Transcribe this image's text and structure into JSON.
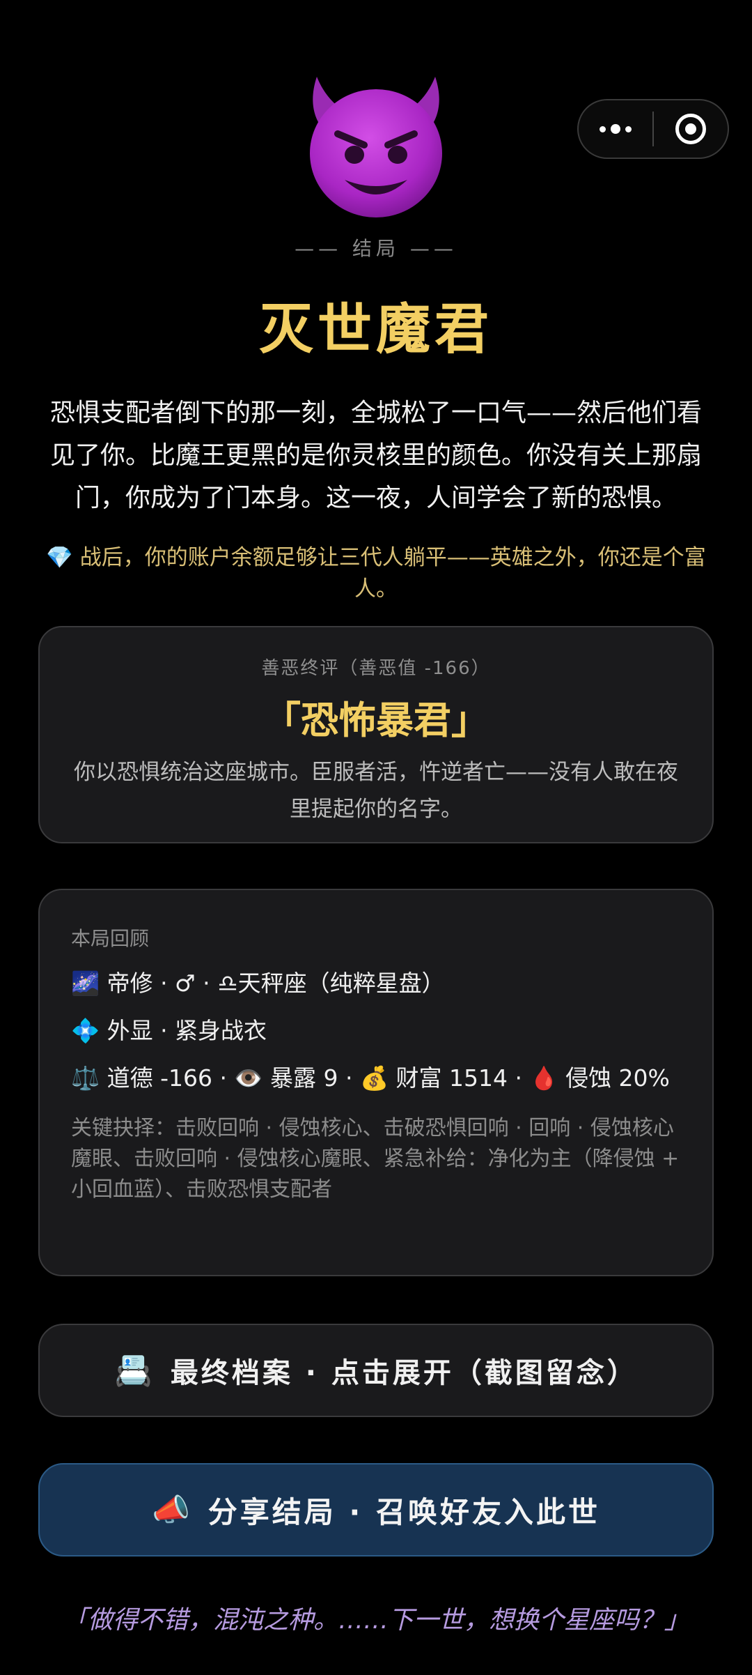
{
  "menu": {
    "more_icon": "more-dots-icon",
    "close_icon": "target-circle-icon"
  },
  "ending": {
    "emoji": "smiling-devil-icon",
    "label": "—— 结局 ——",
    "title": "灭世魔君",
    "story": "恐惧支配者倒下的那一刻，全城松了一口气——然后他们看见了你。比魔王更黑的是你灵核里的颜色。你没有关上那扇门，你成为了门本身。这一夜，人间学会了新的恐惧。",
    "wealth_icon": "💎",
    "wealth_text": "战后，你的账户余额足够让三代人躺平——英雄之外，你还是个富人。"
  },
  "verdict": {
    "heading": "善恶终评（善恶值 -166）",
    "name": "「恐怖暴君」",
    "description": "你以恐惧统治这座城市。臣服者活，忤逆者亡——没有人敢在夜里提起你的名字。"
  },
  "review": {
    "heading": "本局回顾",
    "line1": "🌌 帝修 · ♂ · ♎天秤座（纯粹星盘）",
    "line2": "💠 外显 · 紧身战衣",
    "line3": "⚖️ 道德 -166 · 👁️ 暴露 9 · 💰 财富 1514 · 🩸 侵蚀 20%",
    "choices": "关键抉择：击败回响 · 侵蚀核心、击破恐惧回响 · 回响 · 侵蚀核心魔眼、击败回响 · 侵蚀核心魔眼、紧急补给：净化为主（降侵蚀 + 小回血蓝）、击败恐惧支配者"
  },
  "buttons": {
    "archive_icon": "📇",
    "archive_label": "最终档案 · 点击展开（截图留念）",
    "share_icon": "📣",
    "share_label": "分享结局 · 召唤好友入此世"
  },
  "footer": "「做得不错，混沌之种。……下一世，想换个星座吗？」",
  "colors": {
    "gold": "#f3cf63",
    "share_bg": "#173352",
    "footer_purple": "#b69be0"
  }
}
